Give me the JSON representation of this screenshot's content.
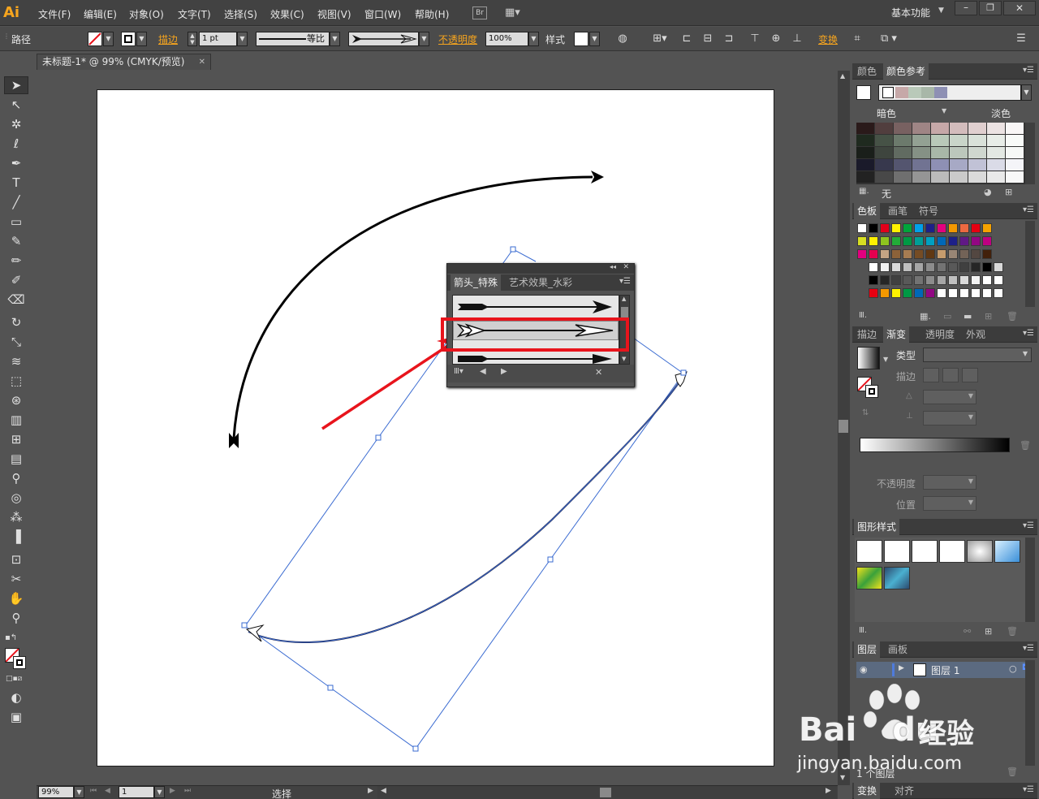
{
  "app": {
    "logo": "Ai"
  },
  "menu": [
    "文件(F)",
    "编辑(E)",
    "对象(O)",
    "文字(T)",
    "选择(S)",
    "效果(C)",
    "视图(V)",
    "窗口(W)",
    "帮助(H)"
  ],
  "bridge_label": "Br",
  "workspace": "基本功能",
  "control_bar": {
    "object_type": "路径",
    "stroke_label": "描边",
    "stroke_weight": "1 pt",
    "profile_label": "等比",
    "opacity_label": "不透明度",
    "opacity_value": "100%",
    "style_label": "样式",
    "transform_label": "变换"
  },
  "document_tab": {
    "title": "未标题-1* @ 99% (CMYK/预览)"
  },
  "arrow_library_panel": {
    "tabs": [
      "箭头_特殊",
      "艺术效果_水彩"
    ],
    "active_tab": 0,
    "selected_item": 1
  },
  "color_guide_panel": {
    "tabs": [
      "颜色",
      "颜色参考"
    ],
    "left_label": "暗色",
    "right_label": "淡色",
    "none_label": "无",
    "harmony_colors": [
      "#c6a8a8",
      "#b9c9b9",
      "#a8b7a8",
      "#8e90b4"
    ]
  },
  "swatches_panel": {
    "tabs": [
      "色板",
      "画笔",
      "符号"
    ],
    "rows": [
      [
        "#ffffff",
        "#000000",
        "#e2001a",
        "#fff100",
        "#00a53b",
        "#00a0e9",
        "#1d2088",
        "#e4007f",
        "#f39800",
        "#ec6941",
        "#e60012",
        "#f5a200"
      ],
      [
        "#d7df21",
        "#fff000",
        "#8fc31f",
        "#22ac38",
        "#009944",
        "#009e96",
        "#00a0c1",
        "#0068b7",
        "#1d2088",
        "#601986",
        "#920783",
        "#be0081"
      ],
      [
        "#e3007f",
        "#e5004f",
        "#c4a484",
        "#8c6239",
        "#a67c52",
        "#754c24",
        "#603813",
        "#c69c6d",
        "#998675",
        "#736357",
        "#534741",
        "#42210b"
      ],
      [
        "#ffffff",
        "#f2f2f2",
        "#d9d9d9",
        "#bfbfbf",
        "#a6a6a6",
        "#8c8c8c",
        "#737373",
        "#595959",
        "#404040",
        "#262626",
        "#000000",
        "#d9d9d9"
      ],
      [
        "#000000",
        "#262626",
        "#404040",
        "#595959",
        "#737373",
        "#8c8c8c",
        "#a6a6a6",
        "#bfbfbf",
        "#d9d9d9",
        "#f2f2f2",
        "#ffffff",
        "#ffffff"
      ],
      [
        "#e60012",
        "#f39800",
        "#fff100",
        "#009944",
        "#0068b7",
        "#920783",
        "#ffffff",
        "#ffffff",
        "#ffffff",
        "#ffffff",
        "#ffffff",
        "#ffffff"
      ]
    ]
  },
  "gradient_panel": {
    "tabs": [
      "描边",
      "渐变",
      "透明度",
      "外观"
    ],
    "type_label": "类型",
    "stroke_label": "描边",
    "opacity_label": "不透明度",
    "position_label": "位置"
  },
  "graphic_styles_panel": {
    "tabs": [
      "图形样式"
    ]
  },
  "layers_panel": {
    "tabs": [
      "图层",
      "画板"
    ],
    "layer_name": "图层 1",
    "count_label": "1 个图层"
  },
  "bottom_panel": {
    "tabs": [
      "变换",
      "对齐"
    ]
  },
  "status_bar": {
    "zoom": "99%",
    "artboard": "1",
    "mode": "选择"
  },
  "watermark": {
    "brand": "Bai",
    "brand2": "du",
    "jingyan": "经验",
    "url": "jingyan.baidu.com"
  },
  "colors": {
    "accent_orange": "#f7a51e",
    "highlight_red": "#e8141c",
    "path_blue": "#3a6bd1"
  }
}
